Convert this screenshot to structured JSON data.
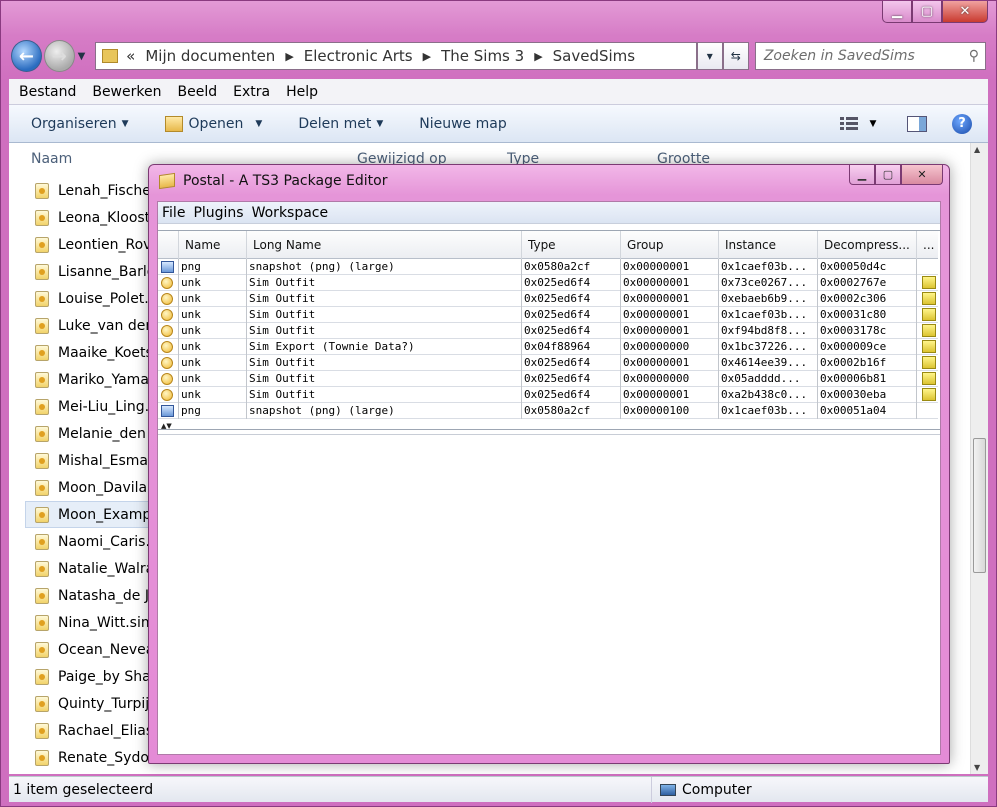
{
  "explorer": {
    "breadcrumb_prefix": "«",
    "breadcrumbs": [
      "Mijn documenten",
      "Electronic Arts",
      "The Sims 3",
      "SavedSims"
    ],
    "search_placeholder": "Zoeken in SavedSims",
    "menu": [
      "Bestand",
      "Bewerken",
      "Beeld",
      "Extra",
      "Help"
    ],
    "toolbar": {
      "organize": "Organiseren",
      "open": "Openen",
      "share": "Delen met",
      "new_folder": "Nieuwe map"
    },
    "columns": [
      "Naam",
      "Gewijzigd op",
      "Type",
      "Grootte"
    ],
    "files": [
      "Lenah_Fischer.",
      "Leona_Klooste",
      "Leontien_Rove",
      "Lisanne_Barlo",
      "Louise_Polet.s",
      "Luke_van der T",
      "Maaike_Koets",
      "Mariko_Yamat",
      "Mei-Liu_Ling.s",
      "Melanie_den H",
      "Mishal_Esmati",
      "Moon_Davilar",
      "Moon_Exampl",
      "Naomi_Caris.s",
      "Natalie_Walra",
      "Natasha_de Jo",
      "Nina_Witt.sim",
      "Ocean_Neveal",
      "Paige_by Shai",
      "Quinty_Turpijn",
      "Rachael_Elias.",
      "Renate_Sydow"
    ],
    "selected_index": 12,
    "status_left": "1 item geselecteerd",
    "status_right": "Computer"
  },
  "postal": {
    "title": "Postal - A TS3 Package Editor",
    "menu": [
      "File",
      "Plugins",
      "Workspace"
    ],
    "columns": [
      "Name",
      "Long Name",
      "Type",
      "Group",
      "Instance",
      "Decompress...",
      "..."
    ],
    "rows": [
      {
        "icon": "png",
        "name": "png",
        "long_name": "snapshot (png) (large)",
        "type": "0x0580a2cf",
        "group": "0x00000001",
        "instance": "0x1caef03b...",
        "decompress": "0x00050d4c",
        "flag": false
      },
      {
        "icon": "unk",
        "name": "unk",
        "long_name": "Sim Outfit",
        "type": "0x025ed6f4",
        "group": "0x00000001",
        "instance": "0x73ce0267...",
        "decompress": "0x0002767e",
        "flag": true
      },
      {
        "icon": "unk",
        "name": "unk",
        "long_name": "Sim Outfit",
        "type": "0x025ed6f4",
        "group": "0x00000001",
        "instance": "0xebaeb6b9...",
        "decompress": "0x0002c306",
        "flag": true
      },
      {
        "icon": "unk",
        "name": "unk",
        "long_name": "Sim Outfit",
        "type": "0x025ed6f4",
        "group": "0x00000001",
        "instance": "0x1caef03b...",
        "decompress": "0x00031c80",
        "flag": true
      },
      {
        "icon": "unk",
        "name": "unk",
        "long_name": "Sim Outfit",
        "type": "0x025ed6f4",
        "group": "0x00000001",
        "instance": "0xf94bd8f8...",
        "decompress": "0x0003178c",
        "flag": true
      },
      {
        "icon": "unk",
        "name": "unk",
        "long_name": "Sim Export (Townie Data?)",
        "type": "0x04f88964",
        "group": "0x00000000",
        "instance": "0x1bc37226...",
        "decompress": "0x000009ce",
        "flag": true
      },
      {
        "icon": "unk",
        "name": "unk",
        "long_name": "Sim Outfit",
        "type": "0x025ed6f4",
        "group": "0x00000001",
        "instance": "0x4614ee39...",
        "decompress": "0x0002b16f",
        "flag": true
      },
      {
        "icon": "unk",
        "name": "unk",
        "long_name": "Sim Outfit",
        "type": "0x025ed6f4",
        "group": "0x00000000",
        "instance": "0x05adddd...",
        "decompress": "0x00006b81",
        "flag": true
      },
      {
        "icon": "unk",
        "name": "unk",
        "long_name": "Sim Outfit",
        "type": "0x025ed6f4",
        "group": "0x00000001",
        "instance": "0xa2b438c0...",
        "decompress": "0x00030eba",
        "flag": true
      },
      {
        "icon": "png",
        "name": "png",
        "long_name": "snapshot (png) (large)",
        "type": "0x0580a2cf",
        "group": "0x00000100",
        "instance": "0x1caef03b...",
        "decompress": "0x00051a04",
        "flag": false
      }
    ]
  }
}
